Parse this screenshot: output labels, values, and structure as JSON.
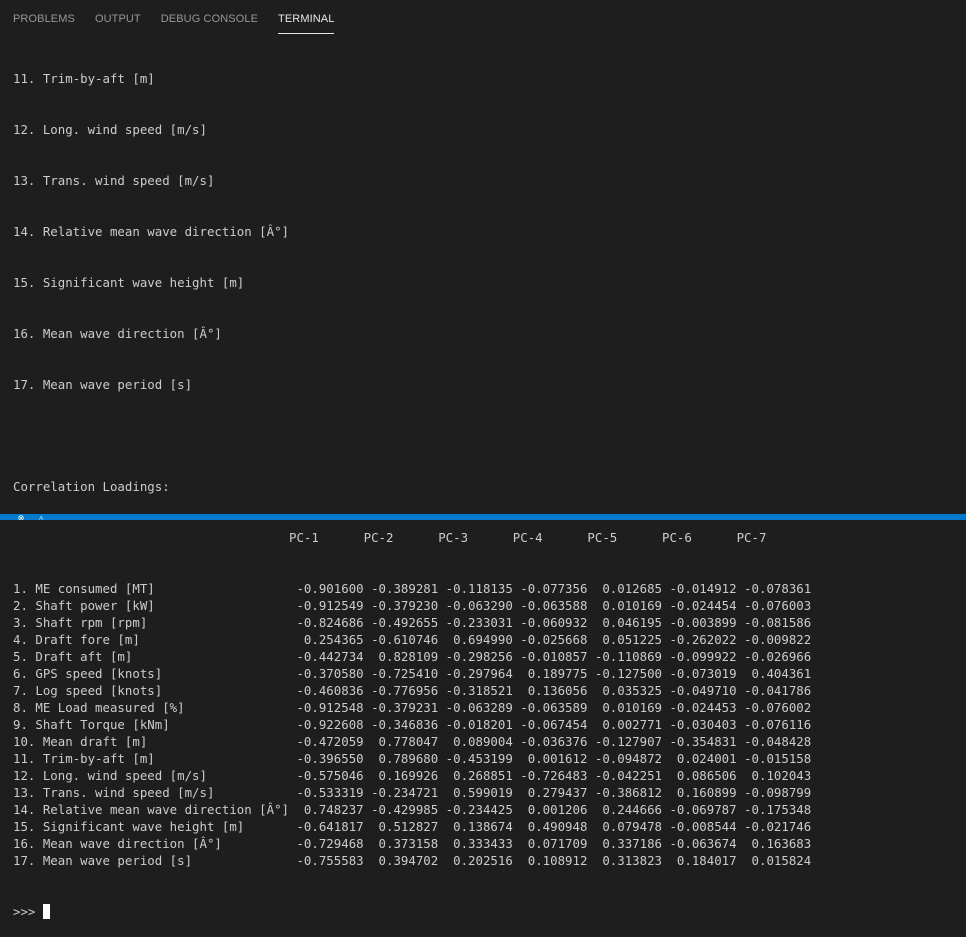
{
  "panel": {
    "tabs": [
      {
        "label": "PROBLEMS",
        "active": false
      },
      {
        "label": "OUTPUT",
        "active": false
      },
      {
        "label": "DEBUG CONSOLE",
        "active": false
      },
      {
        "label": "TERMINAL",
        "active": true
      }
    ]
  },
  "terminal": {
    "pre_lines": [
      "11. Trim-by-aft [m]",
      "12. Long. wind speed [m/s]",
      "13. Trans. wind speed [m/s]",
      "14. Relative mean wave direction [Â°]",
      "15. Significant wave height [m]",
      "16. Mean wave direction [Â°]",
      "17. Mean wave period [s]",
      "",
      "Correlation Loadings:"
    ],
    "table_header": "                                     PC-1      PC-2      PC-3      PC-4      PC-5      PC-6      PC-7",
    "rows": [
      {
        "label": "1. ME consumed [MT]",
        "values": [
          "-0.901600",
          "-0.389281",
          "-0.118135",
          "-0.077356",
          "0.012685",
          "-0.014912",
          "-0.078361"
        ]
      },
      {
        "label": "2. Shaft power [kW]",
        "values": [
          "-0.912549",
          "-0.379230",
          "-0.063290",
          "-0.063588",
          "0.010169",
          "-0.024454",
          "-0.076003"
        ]
      },
      {
        "label": "3. Shaft rpm [rpm]",
        "values": [
          "-0.824686",
          "-0.492655",
          "-0.233031",
          "-0.060932",
          "0.046195",
          "-0.003899",
          "-0.081586"
        ]
      },
      {
        "label": "4. Draft fore [m]",
        "values": [
          "0.254365",
          "-0.610746",
          "0.694990",
          "-0.025668",
          "0.051225",
          "-0.262022",
          "-0.009822"
        ]
      },
      {
        "label": "5. Draft aft [m]",
        "values": [
          "-0.442734",
          "0.828109",
          "-0.298256",
          "-0.010857",
          "-0.110869",
          "-0.099922",
          "-0.026966"
        ]
      },
      {
        "label": "6. GPS speed [knots]",
        "values": [
          "-0.370580",
          "-0.725410",
          "-0.297964",
          "0.189775",
          "-0.127500",
          "-0.073019",
          "0.404361"
        ]
      },
      {
        "label": "7. Log speed [knots]",
        "values": [
          "-0.460836",
          "-0.776956",
          "-0.318521",
          "0.136056",
          "0.035325",
          "-0.049710",
          "-0.041786"
        ]
      },
      {
        "label": "8. ME Load measured [%]",
        "values": [
          "-0.912548",
          "-0.379231",
          "-0.063289",
          "-0.063589",
          "0.010169",
          "-0.024453",
          "-0.076002"
        ]
      },
      {
        "label": "9. Shaft Torque [kNm]",
        "values": [
          "-0.922608",
          "-0.346836",
          "-0.018201",
          "-0.067454",
          "0.002771",
          "-0.030403",
          "-0.076116"
        ]
      },
      {
        "label": "10. Mean draft [m]",
        "values": [
          "-0.472059",
          "0.778047",
          "0.089004",
          "-0.036376",
          "-0.127907",
          "-0.354831",
          "-0.048428"
        ]
      },
      {
        "label": "11. Trim-by-aft [m]",
        "values": [
          "-0.396550",
          "0.789680",
          "-0.453199",
          "0.001612",
          "-0.094872",
          "0.024001",
          "-0.015158"
        ]
      },
      {
        "label": "12. Long. wind speed [m/s]",
        "values": [
          "-0.575046",
          "0.169926",
          "0.268851",
          "-0.726483",
          "-0.042251",
          "0.086506",
          "0.102043"
        ]
      },
      {
        "label": "13. Trans. wind speed [m/s]",
        "values": [
          "-0.533319",
          "-0.234721",
          "0.599019",
          "0.279437",
          "-0.386812",
          "0.160899",
          "-0.098799"
        ]
      },
      {
        "label": "14. Relative mean wave direction [Â°]",
        "values": [
          "0.748237",
          "-0.429985",
          "-0.234425",
          "0.001206",
          "0.244666",
          "-0.069787",
          "-0.175348"
        ]
      },
      {
        "label": "15. Significant wave height [m]",
        "values": [
          "-0.641817",
          "0.512827",
          "0.138674",
          "0.490948",
          "0.079478",
          "-0.008544",
          "-0.021746"
        ]
      },
      {
        "label": "16. Mean wave direction [Â°]",
        "values": [
          "-0.729468",
          "0.373158",
          "0.333433",
          "0.071709",
          "0.337186",
          "-0.063674",
          "0.163683"
        ]
      },
      {
        "label": "17. Mean wave period [s]",
        "values": [
          "-0.755583",
          "0.394702",
          "0.202516",
          "0.108912",
          "0.313823",
          "0.184017",
          "0.015824"
        ]
      }
    ],
    "prompt": ">>> "
  },
  "colors": {
    "background": "#1e1e1e",
    "text": "#cccccc",
    "active_tab": "#e7e7e7",
    "inactive_tab": "#969696",
    "statusbar": "#007acc"
  }
}
